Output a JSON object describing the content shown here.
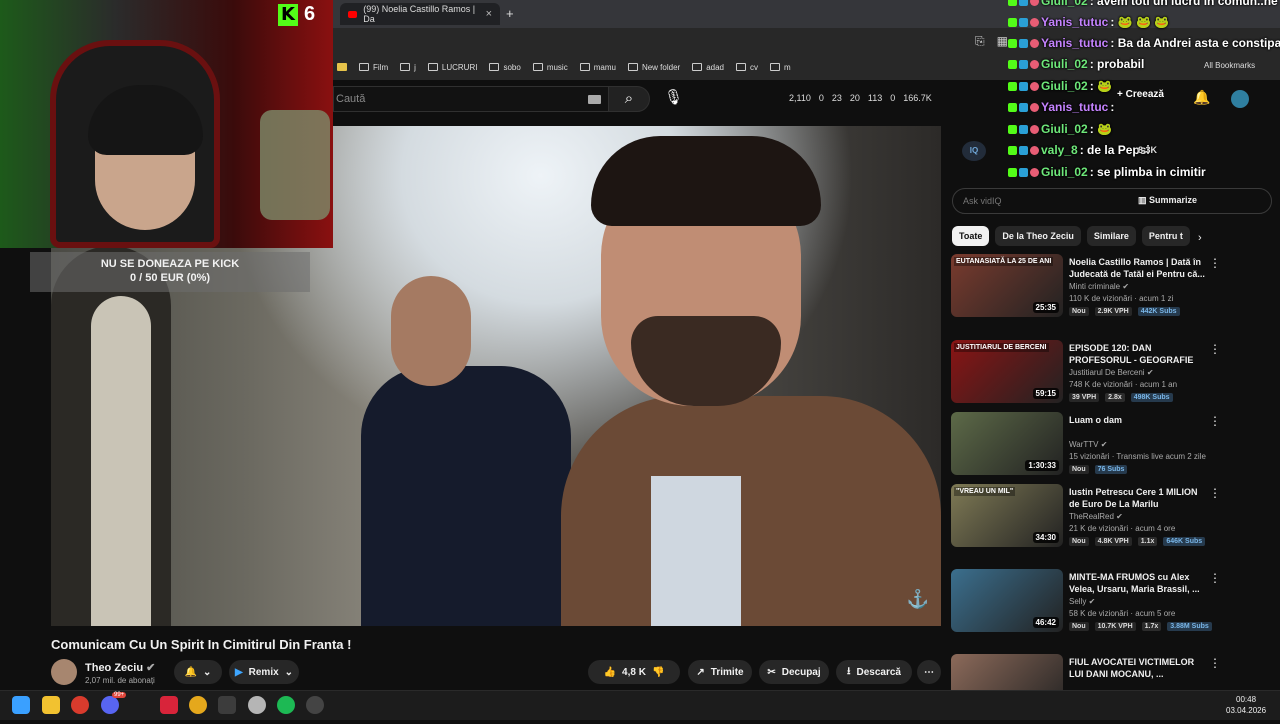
{
  "stream_overlay": {
    "kick_viewers": "6",
    "donation_title": "NU SE DONEAZA PE KICK",
    "donation_progress": "0 / 50 EUR (0%)"
  },
  "browser": {
    "tab_title": "(99) Noelia Castillo Ramos | Da",
    "bookmarks": [
      "Film",
      "j",
      "LUCRURI",
      "sobo",
      "music",
      "mamu",
      "New folder",
      "adad",
      "cv",
      "m"
    ],
    "all_bookmarks": "All Bookmarks"
  },
  "yt_header": {
    "search_placeholder": "Caută",
    "stats": [
      "2,110",
      "0",
      "23",
      "20",
      "113",
      "0",
      "166.7K"
    ],
    "create_label": "Creează"
  },
  "video": {
    "title": "Comunicam Cu Un Spirit In Cimitirul Din Franta !",
    "channel": "Theo Zeciu",
    "subscribers": "2,07 mil. de abonați",
    "remix_label": "Remix",
    "likes": "4,8 K",
    "share_label": "Trimite",
    "clip_label": "Decupaj",
    "download_label": "Descarcă"
  },
  "sidebar": {
    "ask_placeholder": "Ask vidIQ",
    "summarize_label": "Summarize",
    "chips": [
      "Toate",
      "De la Theo Zeciu",
      "Similare",
      "Pentru t"
    ],
    "recommendations": [
      {
        "title": "Noelia Castillo Ramos | Dată în Judecată de Tatăl ei Pentru că...",
        "channel": "Minti criminale",
        "meta": "110 K de vizionări · acum 1 zi",
        "duration": "25:35",
        "new": "Nou",
        "vph": "2.9K VPH",
        "ratio": "",
        "subs": "442K Subs",
        "thumb_color": "#7a3b2e",
        "thumb_text": "EUTANASIATĂ LA 25 DE ANI"
      },
      {
        "title": "EPISODE 120: DAN PROFESORUL - GEOGRAFIE SI...",
        "channel": "Justitiarul De Berceni",
        "meta": "748 K de vizionări · acum 1 an",
        "duration": "59:15",
        "new": "",
        "vph": "39 VPH",
        "ratio": "2.8x",
        "subs": "498K Subs",
        "thumb_color": "#8a1414",
        "thumb_text": "JUSTITIARUL DE BERCENI"
      },
      {
        "title": "Luam o dam",
        "channel": "WarTTV",
        "meta": "15 vizionări · Transmis live acum 2 zile",
        "duration": "1:30:33",
        "new": "Nou",
        "vph": "",
        "ratio": "",
        "subs": "76 Subs",
        "thumb_color": "#5d6a48",
        "thumb_text": ""
      },
      {
        "title": "Iustin Petrescu Cere 1 MILION de Euro De La Marilu",
        "channel": "TheRealRed",
        "meta": "21 K de vizionări · acum 4 ore",
        "duration": "34:30",
        "new": "Nou",
        "vph": "4.8K VPH",
        "ratio": "1.1x",
        "subs": "646K Subs",
        "thumb_color": "#7f7a55",
        "thumb_text": "\"VREAU UN MIL\""
      },
      {
        "title": "MINTE-MA FRUMOS cu Alex Velea, Ursaru, Maria Brassil, ...",
        "channel": "Selly",
        "meta": "58 K de vizionări · acum 5 ore",
        "duration": "46:42",
        "new": "Nou",
        "vph": "10.7K VPH",
        "ratio": "1.7x",
        "subs": "3.88M Subs",
        "thumb_color": "#3b6f8e",
        "thumb_text": ""
      },
      {
        "title": "FIUL AVOCATEI VICTIMELOR LUI DANI MOCANU, ...",
        "channel": "",
        "meta": "",
        "duration": "",
        "new": "",
        "vph": "",
        "ratio": "",
        "subs": "",
        "thumb_color": "#8c6a5a",
        "thumb_text": ""
      }
    ]
  },
  "chat": [
    {
      "user": "Giuli_02",
      "msg": ": avem toti un lucru in comun..he",
      "color": "green"
    },
    {
      "user": "Yanis_tutuc",
      "msg": ": 🐸 🐸 🐸",
      "color": "purple"
    },
    {
      "user": "Yanis_tutuc",
      "msg": ": Ba da Andrei asta e constipat r",
      "color": "purple"
    },
    {
      "user": "Giuli_02",
      "msg": ": probabil",
      "color": "green"
    },
    {
      "user": "Giuli_02",
      "msg": ": 🐸",
      "color": "green"
    },
    {
      "user": "Yanis_tutuc",
      "msg": ":",
      "color": "purple"
    },
    {
      "user": "Giuli_02",
      "msg": ": 🐸",
      "color": "green"
    },
    {
      "user": "valy_8",
      "msg": ": de la Pepsi",
      "color": "green"
    },
    {
      "user": "Giuli_02",
      "msg": ": se plimba in cimitir",
      "color": "green"
    }
  ],
  "sidebar_extra": {
    "pepsi_count": "8.3K"
  },
  "taskbar": {
    "time": "00:48",
    "date": "03.04.2026",
    "discord_badge": "99+"
  }
}
